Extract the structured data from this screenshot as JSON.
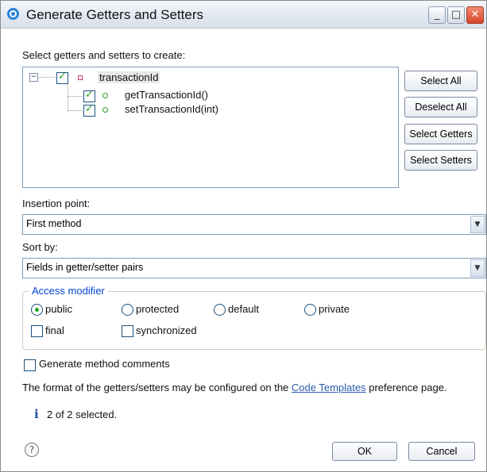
{
  "window": {
    "title": "Generate Getters and Setters",
    "minimize_glyph": "_",
    "maximize_glyph": "□",
    "close_glyph": "✕"
  },
  "header": {
    "select_label": "Select getters and setters to create:"
  },
  "tree": {
    "field": {
      "name": "transactionId",
      "checked": true,
      "icon": "field-icon"
    },
    "methods": [
      {
        "name": "getTransactionId()",
        "checked": true,
        "icon": "method-icon"
      },
      {
        "name": "setTransactionId(int)",
        "checked": true,
        "icon": "method-icon"
      }
    ]
  },
  "side_buttons": {
    "select_all": "Select All",
    "deselect_all": "Deselect All",
    "select_getters": "Select Getters",
    "select_setters": "Select Setters"
  },
  "insertion": {
    "label": "Insertion point:",
    "value": "First method"
  },
  "sort": {
    "label": "Sort by:",
    "value": "Fields in getter/setter pairs"
  },
  "access": {
    "title": "Access modifier",
    "options": [
      "public",
      "protected",
      "default",
      "private"
    ],
    "selected": "public",
    "final_label": "final",
    "synchronized_label": "synchronized"
  },
  "comments": {
    "label": "Generate method comments",
    "checked": false
  },
  "note": {
    "prefix": "The format of the getters/setters may be configured on the ",
    "link": "Code Templates",
    "suffix": " preference page."
  },
  "status": {
    "icon": "info-icon",
    "text": "2 of 2 selected."
  },
  "footer": {
    "help_glyph": "?",
    "ok": "OK",
    "cancel": "Cancel"
  },
  "colors": {
    "accent": "#0046d5",
    "check_green": "#21a121",
    "field_red": "#c63b5b",
    "link": "#2a5db0"
  }
}
